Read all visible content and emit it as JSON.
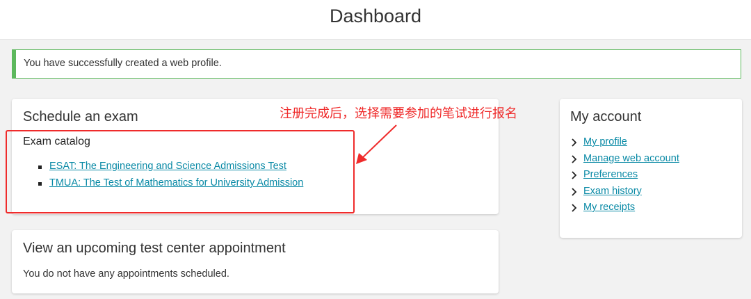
{
  "header": {
    "title": "Dashboard"
  },
  "alert": {
    "message": "You have successfully created a web profile.",
    "color": "#5cb85c"
  },
  "schedule": {
    "title": "Schedule an exam",
    "catalog_heading": "Exam catalog",
    "exams": [
      {
        "label": "ESAT: The Engineering and Science Admissions Test"
      },
      {
        "label": "TMUA: The Test of Mathematics for University Admission"
      }
    ]
  },
  "upcoming": {
    "title": "View an upcoming test center appointment",
    "message": "You do not have any appointments scheduled."
  },
  "account": {
    "title": "My account",
    "links": [
      {
        "label": "My profile"
      },
      {
        "label": "Manage web account"
      },
      {
        "label": "Preferences"
      },
      {
        "label": "Exam history"
      },
      {
        "label": "My receipts"
      }
    ]
  },
  "annotation": {
    "text": "注册完成后，选择需要参加的笔试进行报名",
    "color": "#ef2b2b"
  },
  "colors": {
    "link": "#0a8aa6",
    "background": "#f2f2f2"
  }
}
